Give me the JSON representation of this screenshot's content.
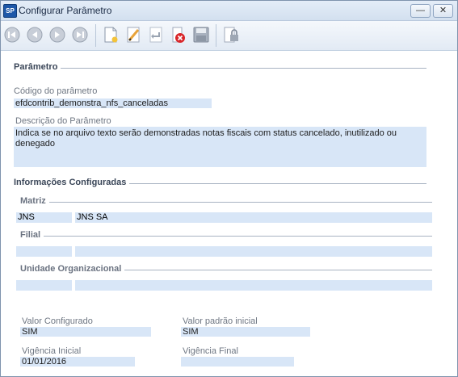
{
  "window": {
    "title": "Configurar Parâmetro",
    "app_icon_text": "SP"
  },
  "section_parametro": {
    "header": "Parâmetro",
    "codigo_label": "Código do parâmetro",
    "codigo_value": "efdcontrib_demonstra_nfs_canceladas",
    "descricao_label": "Descrição do Parâmetro",
    "descricao_value": "Indica se no arquivo texto serão demonstradas notas fiscais com status cancelado, inutilizado ou denegado"
  },
  "section_info": {
    "header": "Informações Configuradas",
    "matriz_label": "Matriz",
    "matriz_code": "JNS",
    "matriz_name": "JNS SA",
    "filial_label": "Filial",
    "filial_code": "",
    "filial_name": "",
    "unidade_label": "Unidade Organizacional",
    "unidade_code": "",
    "unidade_name": ""
  },
  "values": {
    "valor_configurado_label": "Valor Configurado",
    "valor_configurado": "SIM",
    "valor_padrao_label": "Valor padrão inicial",
    "valor_padrao": "SIM",
    "vigencia_inicial_label": "Vigência Inicial",
    "vigencia_inicial": "01/01/2016",
    "vigencia_final_label": "Vigência Final",
    "vigencia_final": ""
  },
  "icons": {
    "first": "first-record-icon",
    "prev": "previous-record-icon",
    "next": "next-record-icon",
    "last": "last-record-icon",
    "new": "new-document-icon",
    "edit": "edit-pencil-icon",
    "undo": "undo-icon",
    "delete": "delete-icon",
    "save": "save-disk-icon",
    "lock": "lock-icon"
  },
  "colors": {
    "field_bg": "#d8e6f7",
    "accent": "#1d57a8",
    "delete_red": "#d9262a"
  }
}
